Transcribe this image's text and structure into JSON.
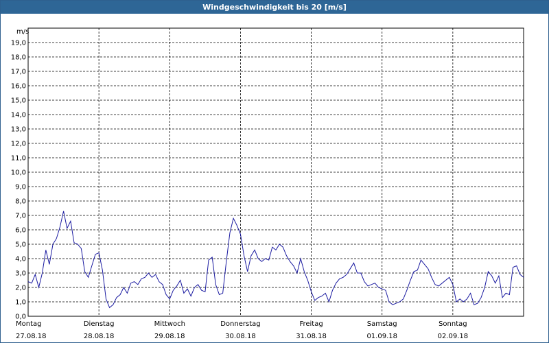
{
  "window": {
    "title": "Windgeschwindigkeit bis 20 [m/s]"
  },
  "chart_data": {
    "type": "line",
    "title": "Windgeschwindigkeit bis 20 [m/s]",
    "ylabel": "m/s",
    "xlabel": "",
    "ylim": [
      0,
      20
    ],
    "grid": true,
    "y_ticks": [
      "0,0",
      "1,0",
      "2,0",
      "3,0",
      "4,0",
      "5,0",
      "6,0",
      "7,0",
      "8,0",
      "9,0",
      "10,0",
      "11,0",
      "12,0",
      "13,0",
      "14,0",
      "15,0",
      "16,0",
      "17,0",
      "18,0",
      "19,0"
    ],
    "x_days": [
      {
        "day": "Montag",
        "date": "27.08.18"
      },
      {
        "day": "Dienstag",
        "date": "28.08.18"
      },
      {
        "day": "Mittwoch",
        "date": "29.08.18"
      },
      {
        "day": "Donnerstag",
        "date": "30.08.18"
      },
      {
        "day": "Freitag",
        "date": "31.08.18"
      },
      {
        "day": "Samstag",
        "date": "01.09.18"
      },
      {
        "day": "Sonntag",
        "date": "02.09.18"
      }
    ],
    "x_unit": "days since 27.08.18 00:00",
    "x_range": [
      0,
      7
    ],
    "series": [
      {
        "color": "#1a1aa0",
        "x": [
          0.0,
          0.05,
          0.1,
          0.15,
          0.2,
          0.25,
          0.3,
          0.35,
          0.4,
          0.45,
          0.5,
          0.55,
          0.6,
          0.65,
          0.7,
          0.75,
          0.8,
          0.85,
          0.9,
          0.95,
          1.0,
          1.05,
          1.1,
          1.15,
          1.2,
          1.25,
          1.3,
          1.35,
          1.4,
          1.45,
          1.5,
          1.55,
          1.6,
          1.65,
          1.7,
          1.75,
          1.8,
          1.85,
          1.9,
          1.95,
          2.0,
          2.05,
          2.1,
          2.15,
          2.2,
          2.25,
          2.3,
          2.35,
          2.4,
          2.45,
          2.5,
          2.55,
          2.6,
          2.65,
          2.7,
          2.75,
          2.8,
          2.85,
          2.9,
          2.95,
          3.0,
          3.05,
          3.1,
          3.15,
          3.2,
          3.25,
          3.3,
          3.35,
          3.4,
          3.45,
          3.5,
          3.55,
          3.6,
          3.65,
          3.7,
          3.75,
          3.8,
          3.85,
          3.9,
          3.95,
          4.0,
          4.05,
          4.1,
          4.15,
          4.2,
          4.25,
          4.3,
          4.35,
          4.4,
          4.45,
          4.5,
          4.55,
          4.6,
          4.65,
          4.7,
          4.75,
          4.8,
          4.85,
          4.9,
          4.95,
          5.0,
          5.05,
          5.1,
          5.15,
          5.2,
          5.25,
          5.3,
          5.35,
          5.4,
          5.45,
          5.5,
          5.55,
          5.6,
          5.65,
          5.7,
          5.75,
          5.8,
          5.85,
          5.9,
          5.95,
          6.0,
          6.05,
          6.1,
          6.15,
          6.2,
          6.25,
          6.3,
          6.35,
          6.4,
          6.45,
          6.5,
          6.55,
          6.6,
          6.65,
          6.7,
          6.75,
          6.8,
          6.85,
          6.9,
          6.95,
          7.0
        ],
        "values": [
          2.4,
          2.3,
          2.9,
          2.0,
          3.0,
          4.6,
          3.6,
          5.0,
          5.4,
          6.2,
          7.3,
          6.1,
          6.6,
          5.1,
          5.0,
          4.7,
          3.1,
          2.7,
          3.5,
          4.3,
          4.4,
          3.2,
          1.2,
          0.6,
          0.8,
          1.3,
          1.5,
          2.0,
          1.6,
          2.3,
          2.4,
          2.2,
          2.6,
          2.7,
          3.0,
          2.7,
          2.9,
          2.4,
          2.2,
          1.5,
          1.2,
          1.8,
          2.1,
          2.5,
          1.6,
          1.9,
          1.4,
          2.0,
          2.2,
          1.8,
          1.7,
          3.9,
          4.1,
          2.2,
          1.5,
          1.6,
          3.8,
          5.8,
          6.8,
          6.3,
          5.7,
          4.2,
          3.1,
          4.2,
          4.6,
          4.0,
          3.8,
          4.0,
          3.9,
          4.8,
          4.6,
          5.0,
          4.8,
          4.2,
          3.8,
          3.5,
          3.0,
          4.0,
          3.1,
          2.5,
          1.7,
          1.1,
          1.3,
          1.4,
          1.6,
          1.0,
          1.8,
          2.3,
          2.6,
          2.7,
          2.9,
          3.3,
          3.7,
          3.0,
          3.0,
          2.4,
          2.1,
          2.2,
          2.3,
          2.0,
          1.9,
          1.8,
          1.0,
          0.8,
          0.9,
          1.0,
          1.2,
          1.8,
          2.5,
          3.1,
          3.2,
          3.9,
          3.6,
          3.3,
          2.7,
          2.2,
          2.1,
          2.3,
          2.5,
          2.7,
          2.2,
          1.0,
          1.2,
          1.0,
          1.2,
          1.6,
          0.8,
          0.9,
          1.3,
          2.0,
          3.1,
          2.8,
          2.3,
          2.8,
          1.3,
          1.6,
          1.5,
          3.4,
          3.5,
          2.9,
          2.7
        ]
      }
    ]
  }
}
